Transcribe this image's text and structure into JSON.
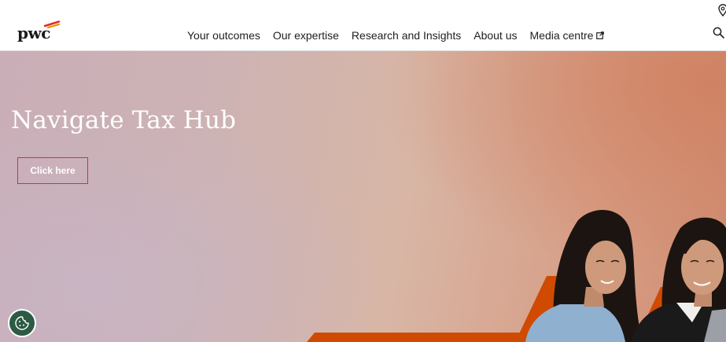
{
  "header": {
    "logo_text": "pwc",
    "nav": [
      {
        "label": "Your outcomes"
      },
      {
        "label": "Our expertise"
      },
      {
        "label": "Research and Insights"
      },
      {
        "label": "About us"
      },
      {
        "label": "Media centre",
        "external": true
      }
    ],
    "icons": {
      "location": "location-pin-icon",
      "search": "search-icon",
      "external": "external-link-icon"
    }
  },
  "hero": {
    "title": "Navigate Tax Hub",
    "cta_label": "Click here",
    "image": "two-women-smiling-at-laptop"
  },
  "cookie": {
    "icon": "cookie-icon"
  },
  "colors": {
    "brand_orange": "#e0301e",
    "brand_orange_light": "#eb8c00",
    "cookie_green": "#2d5a44",
    "accent_stripe": "#d04a02"
  }
}
